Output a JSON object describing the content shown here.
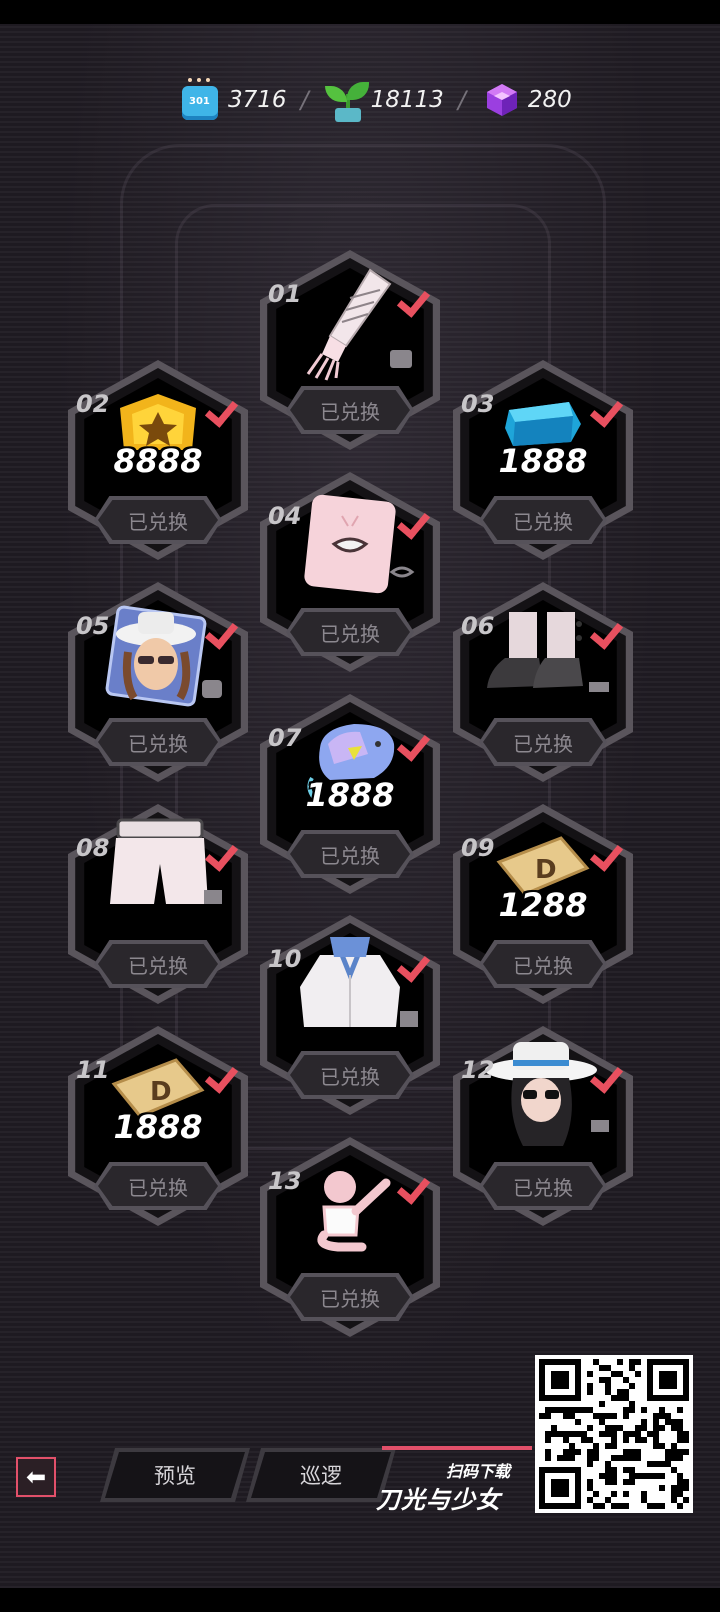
{
  "currencies": [
    {
      "icon": "ticket-icon",
      "value": "3716"
    },
    {
      "icon": "sprout-icon",
      "value": "18113"
    },
    {
      "icon": "purple-cube-icon",
      "value": "280"
    }
  ],
  "separator": "/",
  "redeemed_label": "已兑换",
  "rewards": [
    {
      "num": "01",
      "icon": "glove-icon",
      "amount": ""
    },
    {
      "num": "02",
      "icon": "gold-badge-icon",
      "amount": "8888"
    },
    {
      "num": "03",
      "icon": "blue-gem-icon",
      "amount": "1888"
    },
    {
      "num": "04",
      "icon": "mouth-face-icon",
      "amount": ""
    },
    {
      "num": "05",
      "icon": "character-portrait-icon",
      "amount": ""
    },
    {
      "num": "06",
      "icon": "boots-icon",
      "amount": ""
    },
    {
      "num": "07",
      "icon": "crystal-icon",
      "amount": "1888"
    },
    {
      "num": "08",
      "icon": "pants-icon",
      "amount": ""
    },
    {
      "num": "09",
      "icon": "d-coupon-icon",
      "amount": "1288"
    },
    {
      "num": "10",
      "icon": "jacket-icon",
      "amount": ""
    },
    {
      "num": "11",
      "icon": "d-coupon-icon",
      "amount": "1888"
    },
    {
      "num": "12",
      "icon": "hat-head-icon",
      "amount": ""
    },
    {
      "num": "13",
      "icon": "pose-emote-icon",
      "amount": ""
    }
  ],
  "bottom_nav": {
    "back_icon": "back-arrow-icon",
    "preview": "预览",
    "patrol": "巡逻"
  },
  "promo": {
    "scan": "扫码下载",
    "game_name": "刀光与少女"
  },
  "colors": {
    "accent": "#e8505f",
    "background": "#1e1a21"
  }
}
